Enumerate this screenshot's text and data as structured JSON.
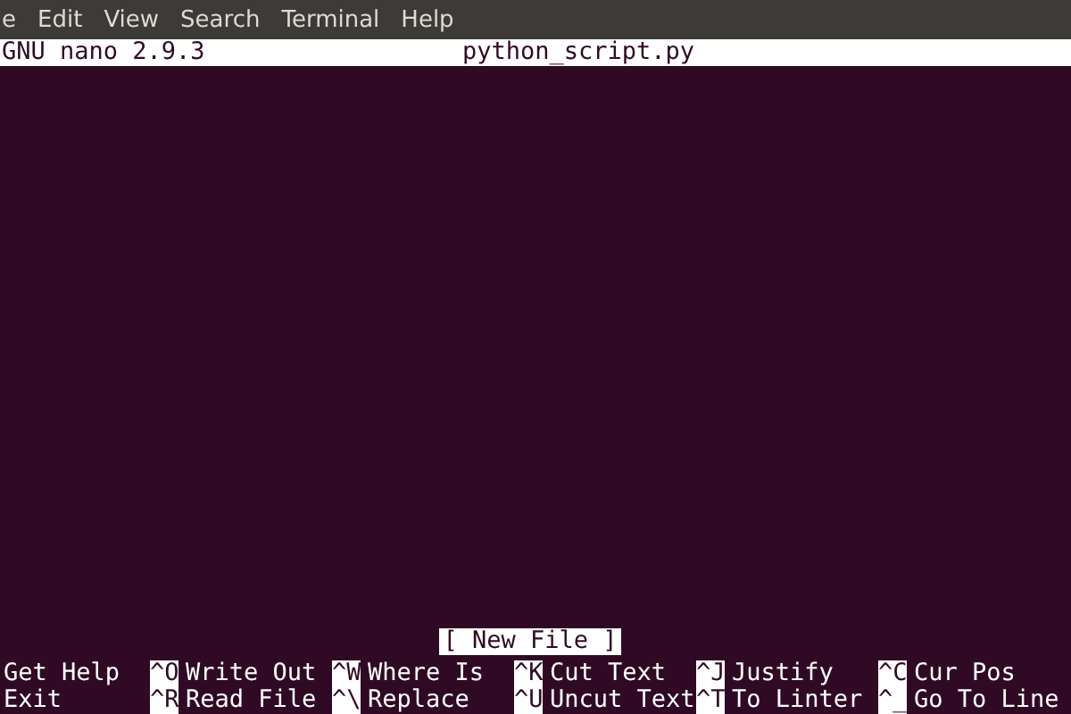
{
  "menu_bar": [
    "e",
    "Edit",
    "View",
    "Search",
    "Terminal",
    "Help"
  ],
  "title_bar": {
    "version": "GNU nano 2.9.3",
    "filename": "python_script.py"
  },
  "status": "[ New File ]",
  "shortcuts": [
    {
      "label": "Get Help"
    },
    {
      "key": "^O",
      "label": "Write Out"
    },
    {
      "key": "^W",
      "label": "Where Is"
    },
    {
      "key": "^K",
      "label": "Cut Text"
    },
    {
      "key": "^J",
      "label": "Justify"
    },
    {
      "key": "^C",
      "label": "Cur Pos"
    },
    {
      "label": "Exit"
    },
    {
      "key": "^R",
      "label": "Read File"
    },
    {
      "key": "^\\",
      "label": "Replace"
    },
    {
      "key": "^U",
      "label": "Uncut Text"
    },
    {
      "key": "^T",
      "label": "To Linter"
    },
    {
      "key": "^_",
      "label": "Go To Line"
    }
  ]
}
